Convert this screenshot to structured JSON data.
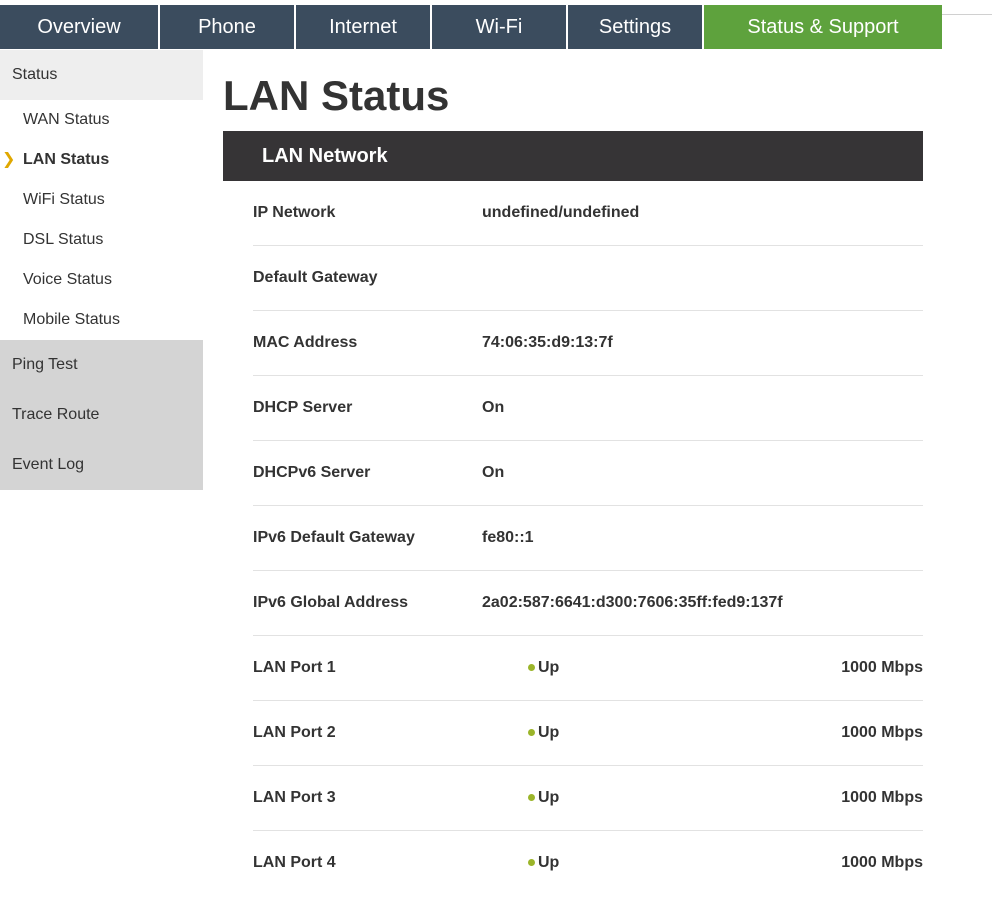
{
  "nav": {
    "tabs": [
      {
        "label": "Overview",
        "active": false
      },
      {
        "label": "Phone",
        "active": false
      },
      {
        "label": "Internet",
        "active": false
      },
      {
        "label": "Wi-Fi",
        "active": false
      },
      {
        "label": "Settings",
        "active": false
      },
      {
        "label": "Status & Support",
        "active": true
      }
    ],
    "colors": {
      "tab": "#3b4c5e",
      "active": "#5ea23d"
    }
  },
  "sidebar": {
    "header": "Status",
    "sub_items": [
      {
        "label": "WAN Status",
        "active": false
      },
      {
        "label": "LAN Status",
        "active": true
      },
      {
        "label": "WiFi Status",
        "active": false
      },
      {
        "label": "DSL Status",
        "active": false
      },
      {
        "label": "Voice Status",
        "active": false
      },
      {
        "label": "Mobile Status",
        "active": false
      }
    ],
    "active_marker": "❯",
    "items": [
      {
        "label": "Ping Test"
      },
      {
        "label": "Trace Route"
      },
      {
        "label": "Event Log"
      }
    ]
  },
  "main": {
    "title": "LAN Status",
    "section_title": "LAN Network",
    "info_rows": [
      {
        "label": "IP Network",
        "value": "undefined/undefined"
      },
      {
        "label": "Default Gateway",
        "value": ""
      },
      {
        "label": "MAC Address",
        "value": "74:06:35:d9:13:7f"
      },
      {
        "label": "DHCP Server",
        "value": "On"
      },
      {
        "label": "DHCPv6 Server",
        "value": "On"
      },
      {
        "label": "IPv6 Default Gateway",
        "value": "fe80::1"
      },
      {
        "label": "IPv6 Global Address",
        "value": "2a02:587:6641:d300:7606:35ff:fed9:137f"
      }
    ],
    "ports": [
      {
        "label": "LAN Port 1",
        "status": "Up",
        "speed": "1000 Mbps"
      },
      {
        "label": "LAN Port 2",
        "status": "Up",
        "speed": "1000 Mbps"
      },
      {
        "label": "LAN Port 3",
        "status": "Up",
        "speed": "1000 Mbps"
      },
      {
        "label": "LAN Port 4",
        "status": "Up",
        "speed": "1000 Mbps"
      }
    ],
    "status_dot_color": "#9bb52a"
  }
}
